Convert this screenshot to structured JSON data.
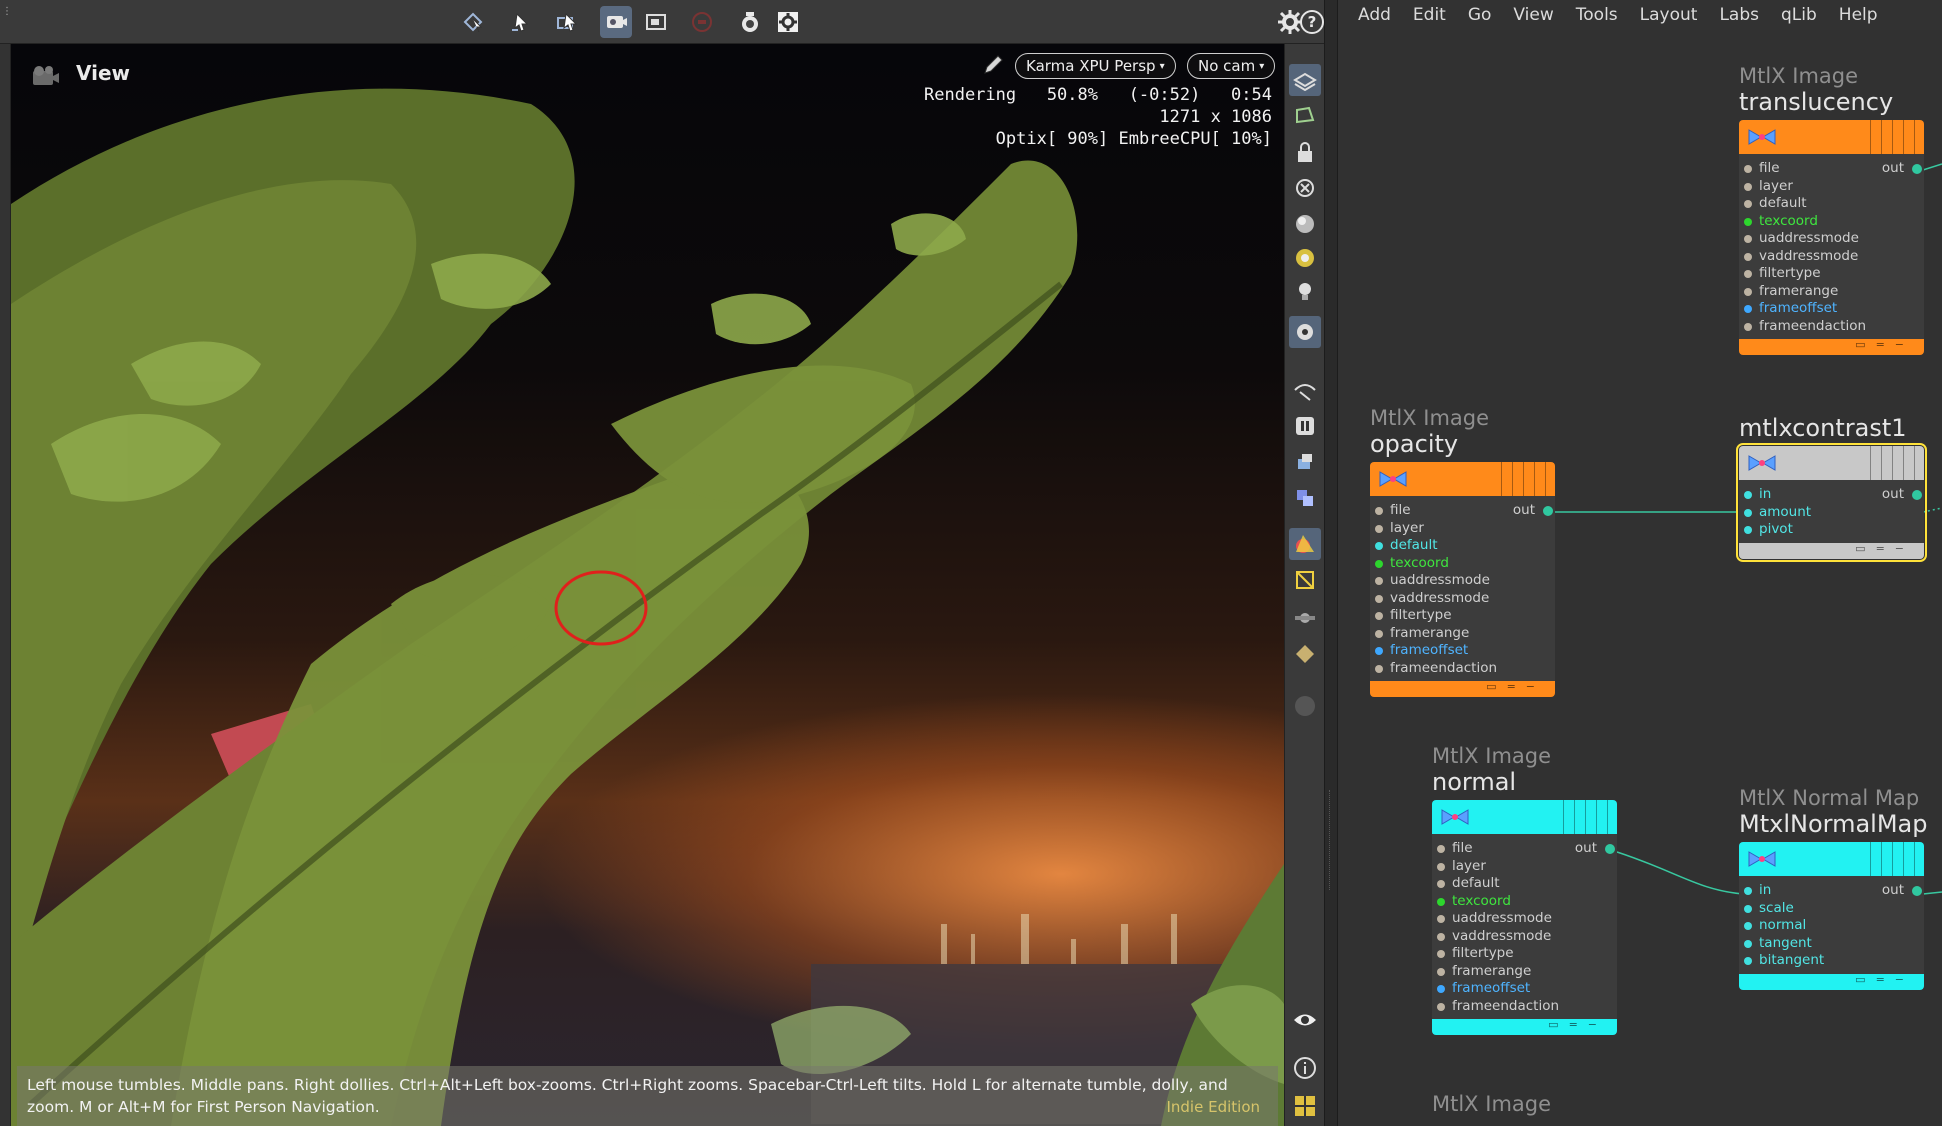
{
  "viewport": {
    "label": "View",
    "renderer": "Karma XPU Persp",
    "camera": "No cam",
    "stats": {
      "line1": "Rendering   50.8%   (-0:52)   0:54",
      "line2": "1271 x 1086",
      "line3": "Optix[ 90%] EmbreeCPU[ 10%]"
    },
    "hint": "Left mouse tumbles. Middle pans. Right dollies. Ctrl+Alt+Left box-zooms. Ctrl+Right zooms. Spacebar-Ctrl-Left tilts. Hold L for alternate tumble, dolly, and zoom. M or Alt+M for First Person Navigation.",
    "edition": "Indie Edition"
  },
  "menu": [
    "Add",
    "Edit",
    "Go",
    "View",
    "Tools",
    "Layout",
    "Labs",
    "qLib",
    "Help"
  ],
  "nodes": {
    "translucency": {
      "type": "MtlX Image",
      "name": "translucency",
      "out": "out",
      "ports": [
        "file",
        "layer",
        "default",
        "texcoord",
        "uaddressmode",
        "vaddressmode",
        "filtertype",
        "framerange",
        "frameoffset",
        "frameendaction"
      ]
    },
    "opacity": {
      "type": "MtlX Image",
      "name": "opacity",
      "out": "out",
      "ports": [
        "file",
        "layer",
        "default",
        "texcoord",
        "uaddressmode",
        "vaddressmode",
        "filtertype",
        "framerange",
        "frameoffset",
        "frameendaction"
      ]
    },
    "contrast": {
      "type": "",
      "name": "mtlxcontrast1",
      "out": "out",
      "ports": [
        "in",
        "amount",
        "pivot"
      ]
    },
    "normal": {
      "type": "MtlX Image",
      "name": "normal",
      "out": "out",
      "ports": [
        "file",
        "layer",
        "default",
        "texcoord",
        "uaddressmode",
        "vaddressmode",
        "filtertype",
        "framerange",
        "frameoffset",
        "frameendaction"
      ]
    },
    "normalmap": {
      "type": "MtlX Normal Map",
      "name": "MtxlNormalMap",
      "out": "out",
      "ports": [
        "in",
        "scale",
        "normal",
        "tangent",
        "bitangent"
      ]
    },
    "partial": {
      "type": "MtlX Image"
    }
  },
  "colors": {
    "orange": "#ff8a1a",
    "cyan": "#22f2f2",
    "selected": "#ffe23a",
    "accent": "#5a6a80"
  }
}
